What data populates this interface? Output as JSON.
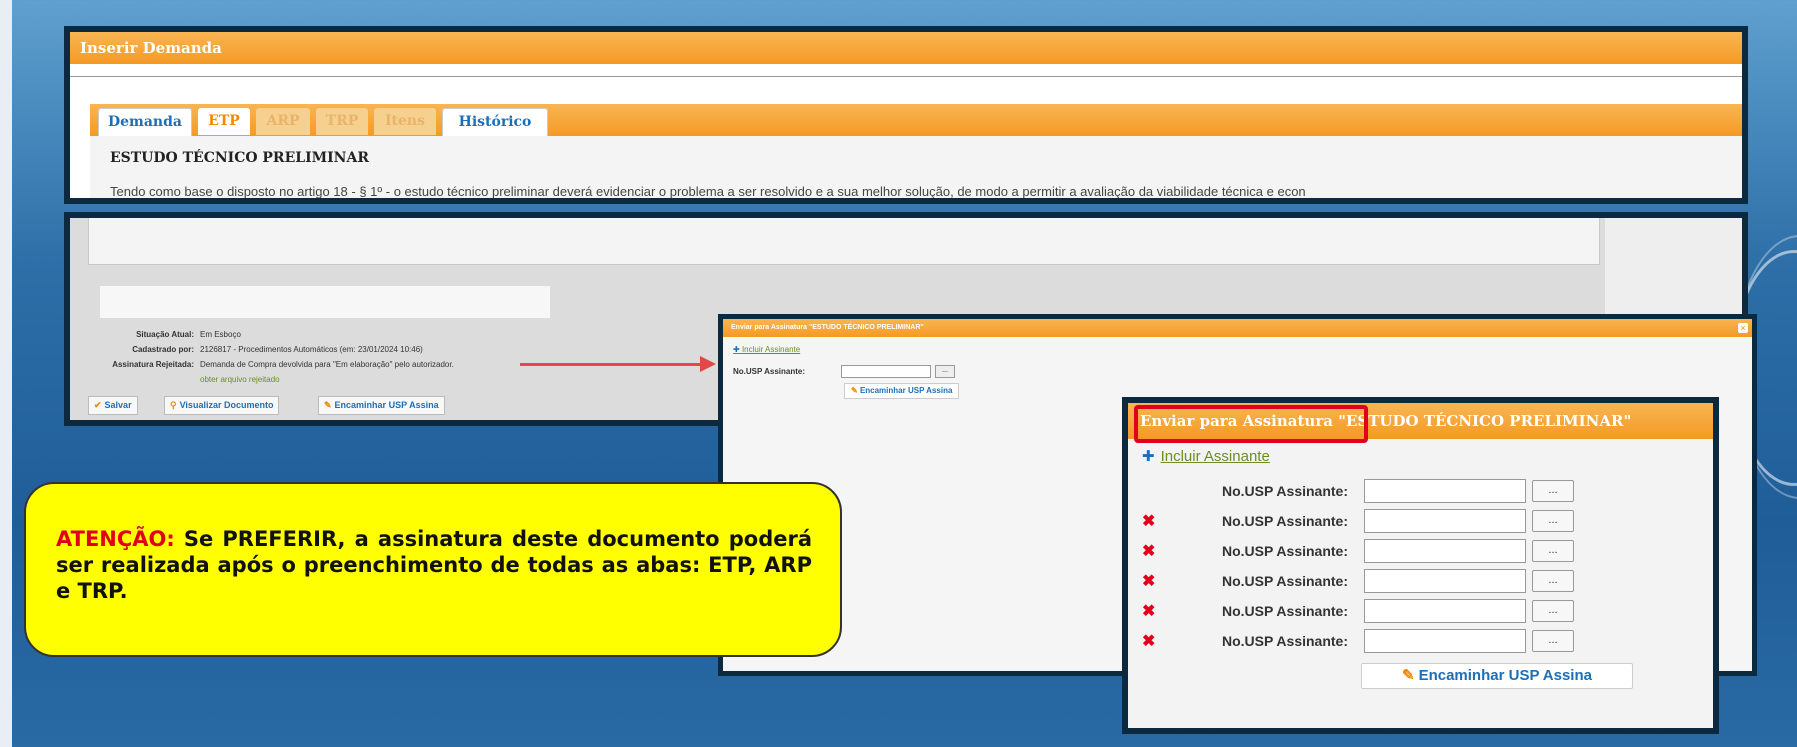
{
  "panel1": {
    "title": "Inserir Demanda",
    "tabs": [
      {
        "label": "Demanda",
        "state": "enabled"
      },
      {
        "label": "ETP",
        "state": "active"
      },
      {
        "label": "ARP",
        "state": "disabled"
      },
      {
        "label": "TRP",
        "state": "disabled"
      },
      {
        "label": "Itens",
        "state": "disabled"
      },
      {
        "label": "Histórico",
        "state": "enabled"
      }
    ],
    "heading": "ESTUDO TÉCNICO PRELIMINAR",
    "paragraph": "Tendo como base o disposto no artigo 18 - § 1º - o estudo técnico preliminar deverá evidenciar o problema a ser resolvido e a sua melhor solução, de modo a permitir a avaliação da viabilidade técnica e econ"
  },
  "panel2": {
    "situacao_label": "Situação Atual:",
    "situacao_value": "Em Esboço",
    "cadastrado_label": "Cadastrado por:",
    "cadastrado_value": "2126817 - Procedimentos Automáticos (em: 23/01/2024 10:46)",
    "rejeitada_label": "Assinatura Rejeitada:",
    "rejeitada_value": "Demanda de Compra devolvida para \"Em elaboração\" pelo autorizador.",
    "rejeitada_link": "obter arquivo rejeitado",
    "buttons": {
      "salvar": "Salvar",
      "visualizar": "Visualizar Documento",
      "encaminhar": "Encaminhar USP Assina"
    }
  },
  "dialog_small": {
    "title": "Enviar para Assinatura \"ESTUDO TÉCNICO PRELIMINAR\"",
    "close": "×",
    "include_link": "Incluir Assinante",
    "field_label": "No.USP Assinante:",
    "dots": "...",
    "submit": "Encaminhar USP Assina"
  },
  "dialog_zoom": {
    "title": "Enviar para Assinatura \"ESTUDO TÉCNICO PRELIMINAR\"",
    "include_link": "Incluir Assinante",
    "field_label": "No.USP Assinante:",
    "dots": "...",
    "submit": "Encaminhar USP Assina"
  },
  "callout": {
    "attention": "ATENÇÃO:",
    "text": " Se PREFERIR, a assinatura deste documento poderá ser realizada após o preenchimento de todas as abas: ETP, ARP e TRP."
  },
  "colors": {
    "accent_orange": "#f49a25",
    "link_blue": "#1c6fb7",
    "highlight_red": "#e0001b",
    "callout_yellow": "#ffff00"
  }
}
